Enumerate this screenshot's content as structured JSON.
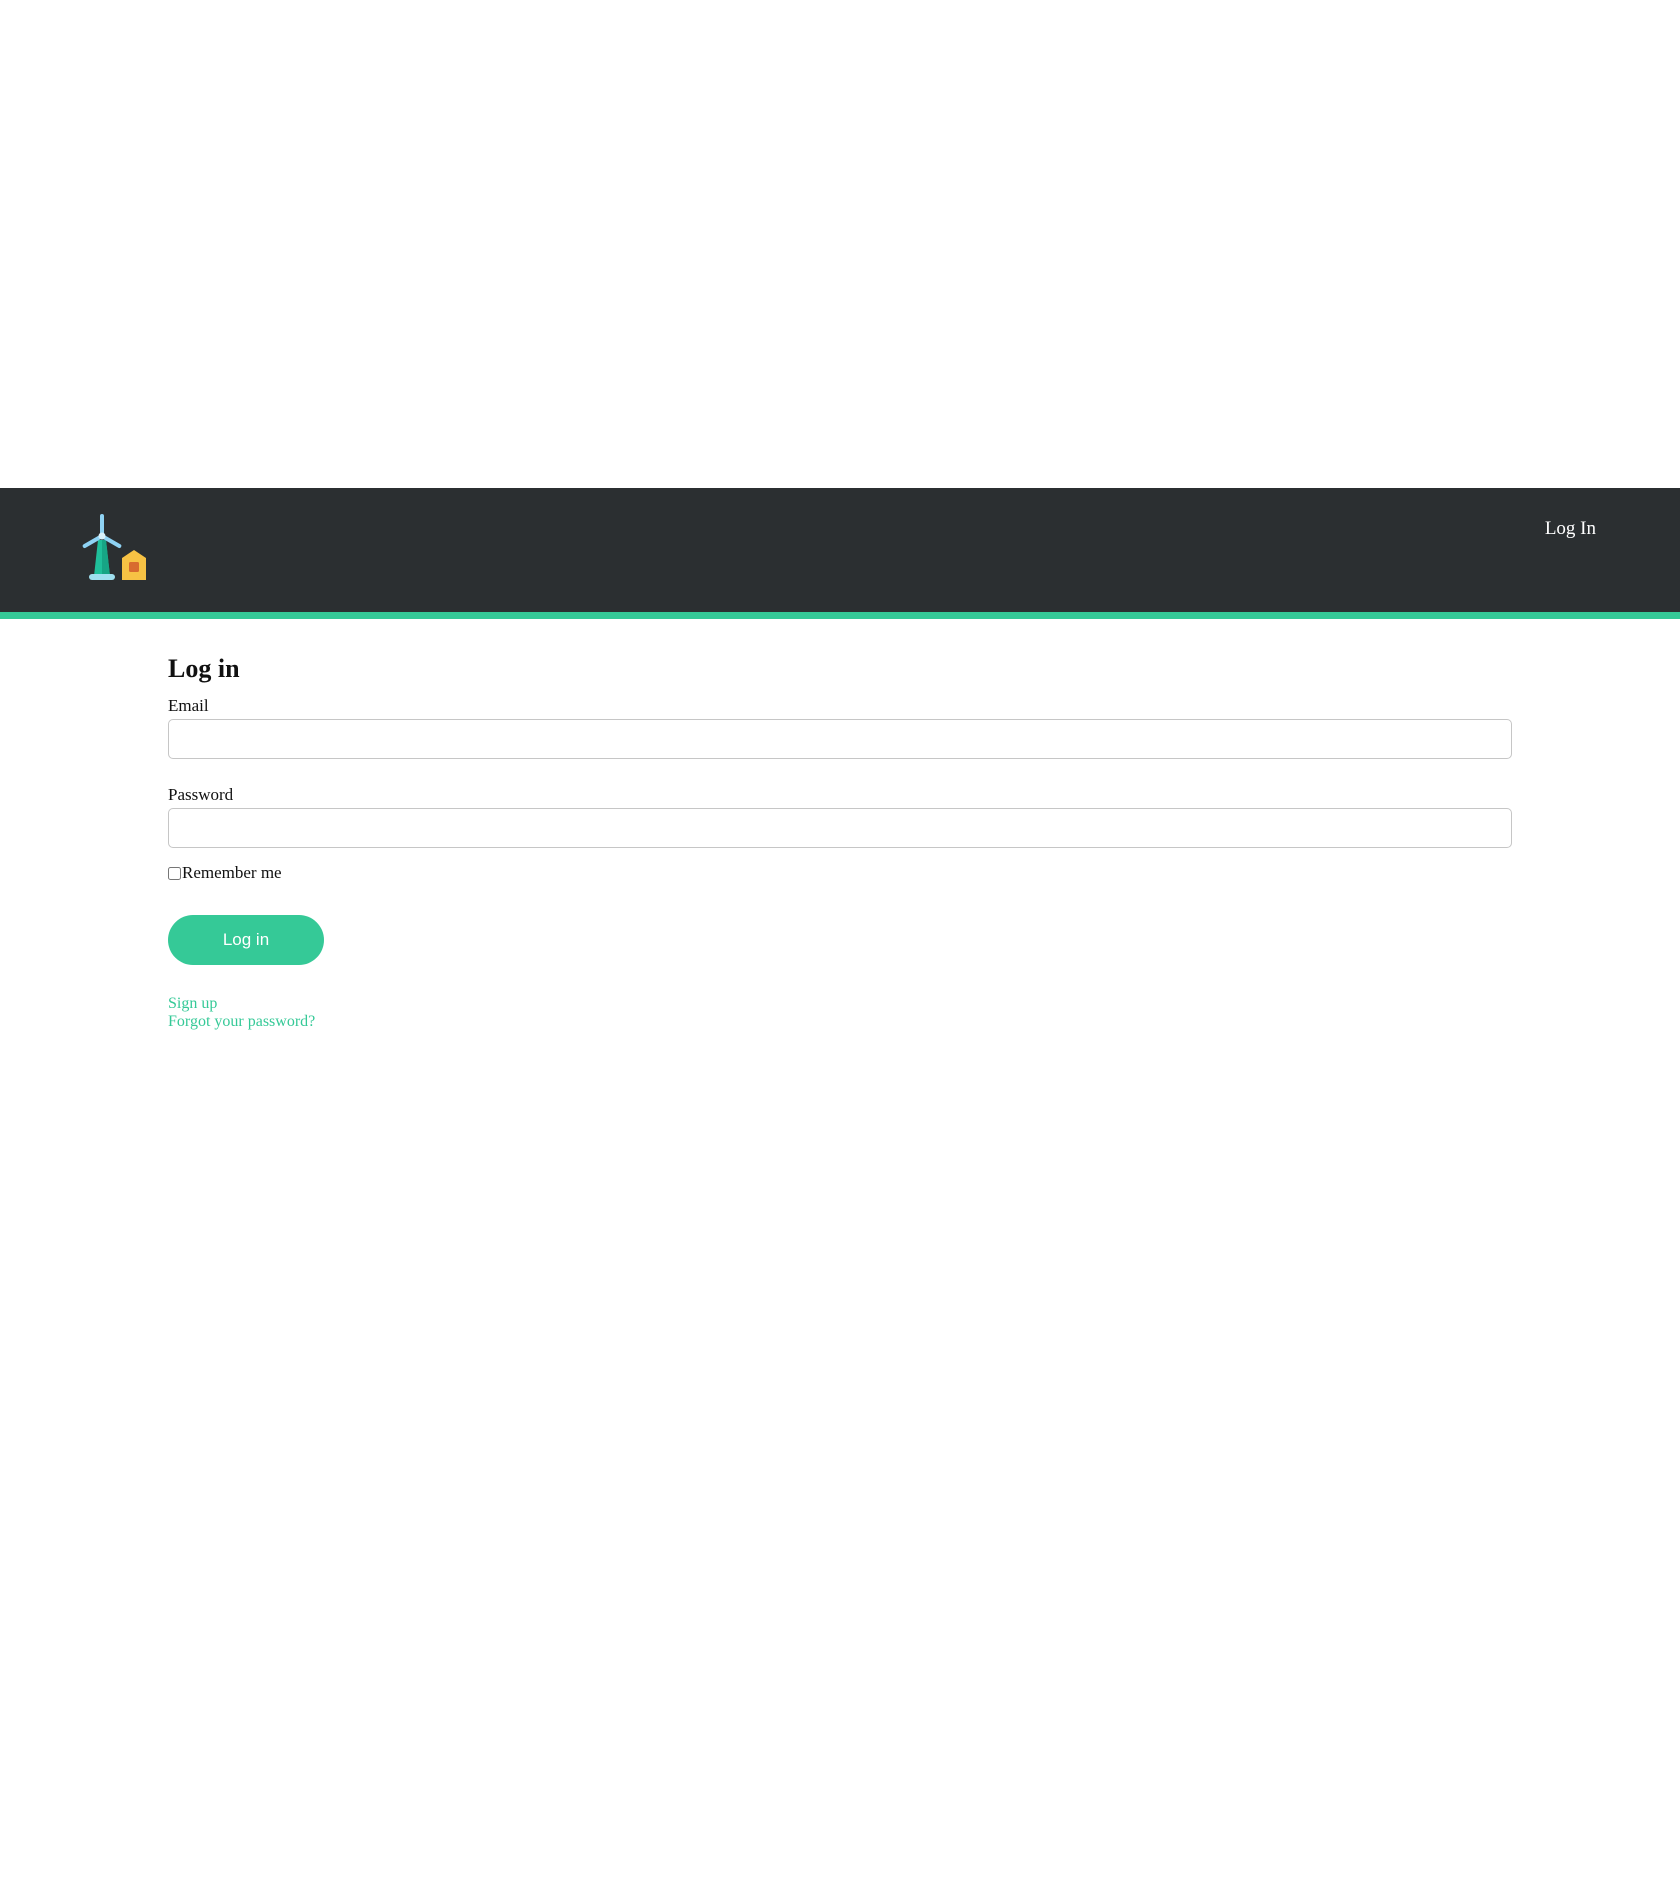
{
  "navbar": {
    "logo": "wind-turbine-house-logo",
    "login_link": "Log In"
  },
  "form": {
    "title": "Log in",
    "email_label": "Email",
    "email_value": "",
    "password_label": "Password",
    "password_value": "",
    "remember_label": "Remember me",
    "remember_checked": false,
    "submit_label": "Log in"
  },
  "links": {
    "sign_up": "Sign up",
    "forgot_password": "Forgot your password?"
  },
  "colors": {
    "navbar_bg": "#2b2f31",
    "accent": "#35c997",
    "logo_tower": "#1fbf9a",
    "logo_blades": "#8fd3f4",
    "logo_house": "#f7c244",
    "logo_window": "#d86b2f"
  }
}
